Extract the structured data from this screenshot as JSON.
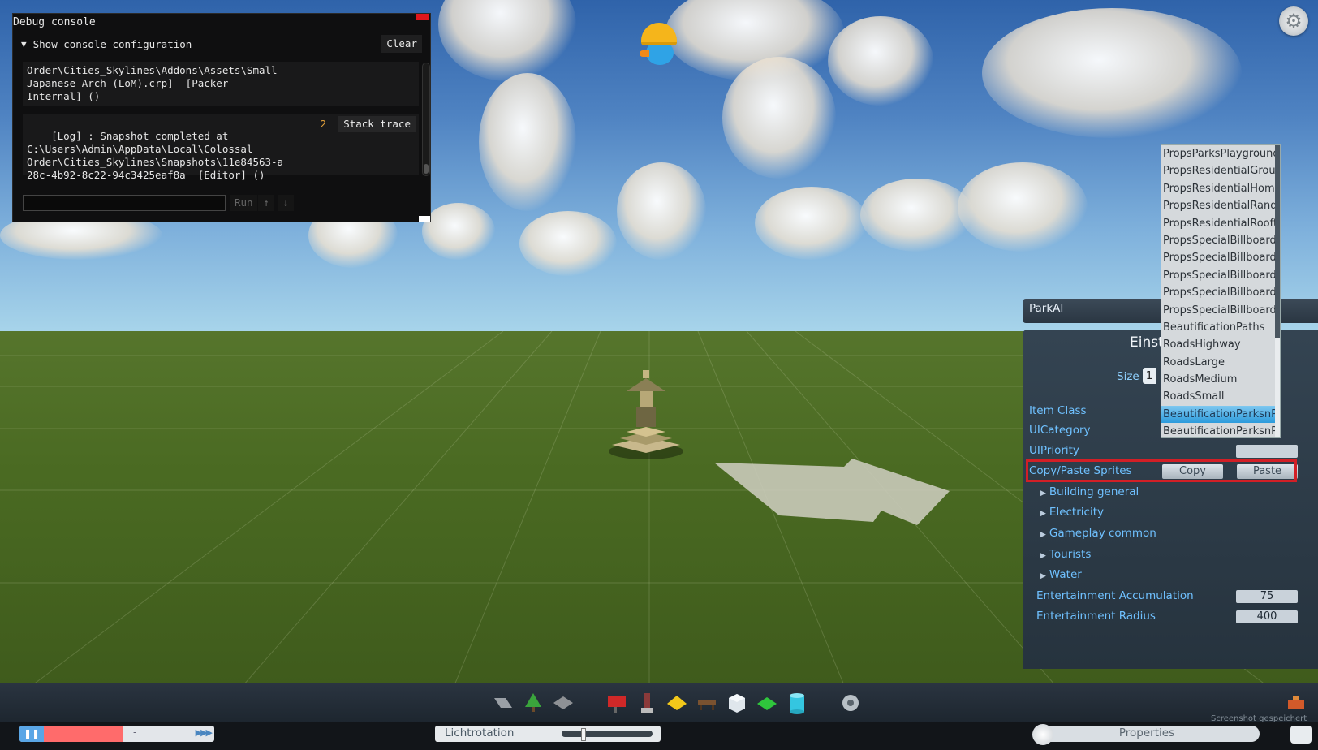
{
  "console": {
    "title": "Debug console",
    "config_toggle": "Show console configuration",
    "clear": "Clear",
    "log1": "Order\\Cities_Skylines\\Addons\\Assets\\Small\nJapanese Arch (LoM).crp]  [Packer -\nInternal] ()",
    "log2": "[Log] : Snapshot completed at\nC:\\Users\\Admin\\AppData\\Local\\Colossal\nOrder\\Cities_Skylines\\Snapshots\\11e84563-a\n28c-4b92-8c22-94c3425eaf8a  [Editor] ()",
    "log2_count": "2",
    "stack_trace": "Stack trace",
    "input_value": "",
    "run": "Run",
    "up": "↑",
    "down": "↓"
  },
  "panel": {
    "ai_name": "ParkAI",
    "heading": "Einst",
    "size_label": "Size",
    "size_value": "1",
    "item_class_label": "Item Class",
    "ui_category_label": "UICategory",
    "ui_priority_label": "UIPriority",
    "ui_priority_value": "",
    "copy_paste_label": "Copy/Paste Sprites",
    "copy": "Copy",
    "paste": "Paste",
    "groups": [
      "Building general",
      "Electricity",
      "Gameplay common",
      "Tourists",
      "Water"
    ],
    "entertainment_accumulation_label": "Entertainment Accumulation",
    "entertainment_accumulation": "75",
    "entertainment_radius_label": "Entertainment Radius",
    "entertainment_radius": "400"
  },
  "dropdown": {
    "options": [
      "PropsParksPlayground",
      "PropsResidentialGroun",
      "PropsResidentialHomeY",
      "PropsResidentialRando",
      "PropsResidentialRoofto",
      "PropsSpecialBillboards",
      "PropsSpecialBillboardsA",
      "PropsSpecialBillboards",
      "PropsSpecialBillboards",
      "PropsSpecialBillboards",
      "BeautificationPaths",
      "RoadsHighway",
      "RoadsLarge",
      "RoadsMedium",
      "RoadsSmall",
      "BeautificationParksnPla",
      "BeautificationParksnPlaza"
    ],
    "selected_index": 15,
    "scroll_fraction": 0.66
  },
  "bottom": {
    "light_label": "Lichtrotation",
    "properties_label": "Properties",
    "speed_separator": "-",
    "screenshot_note": "Screenshot gespeichert"
  },
  "toolbar_icons": [
    "road-tool-icon",
    "tree-icon",
    "surface-icon",
    "billboard-icon",
    "statue-icon",
    "yellow-sign-icon",
    "bench-icon",
    "box-icon",
    "green-plate-icon",
    "cylinder-icon",
    "settings-icon"
  ],
  "colors": {
    "highlight": "#d21f26",
    "label_blue": "#6fc1ff",
    "close_red": "#e0161b"
  }
}
